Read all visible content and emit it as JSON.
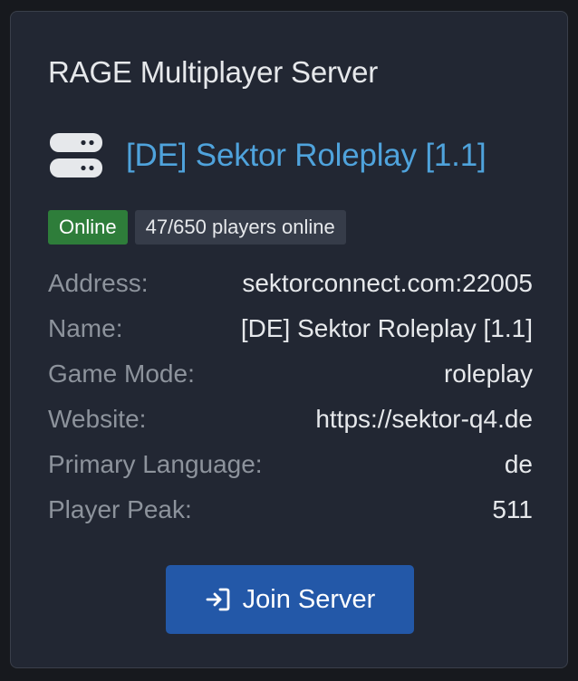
{
  "card": {
    "title": "RAGE Multiplayer Server"
  },
  "server": {
    "name": "[DE] Sektor Roleplay [1.1]",
    "icon": "server-icon",
    "status": "Online",
    "players": "47/650 players online"
  },
  "details": [
    {
      "label": "Address:",
      "value": "sektorconnect.com:22005"
    },
    {
      "label": "Name:",
      "value": "[DE] Sektor Roleplay [1.1]"
    },
    {
      "label": "Game Mode:",
      "value": "roleplay"
    },
    {
      "label": "Website:",
      "value": "https://sektor-q4.de"
    },
    {
      "label": "Primary Language:",
      "value": "de"
    },
    {
      "label": "Player Peak:",
      "value": "511"
    }
  ],
  "join_button": {
    "label": "Join Server",
    "icon": "sign-in-icon"
  },
  "colors": {
    "page_background": "#17191e",
    "card_background": "#222733",
    "link": "#4fa3dc",
    "online_badge": "#2e7d3a",
    "players_badge": "#363c49",
    "button": "#2358a8",
    "label_text": "#8d939c"
  }
}
